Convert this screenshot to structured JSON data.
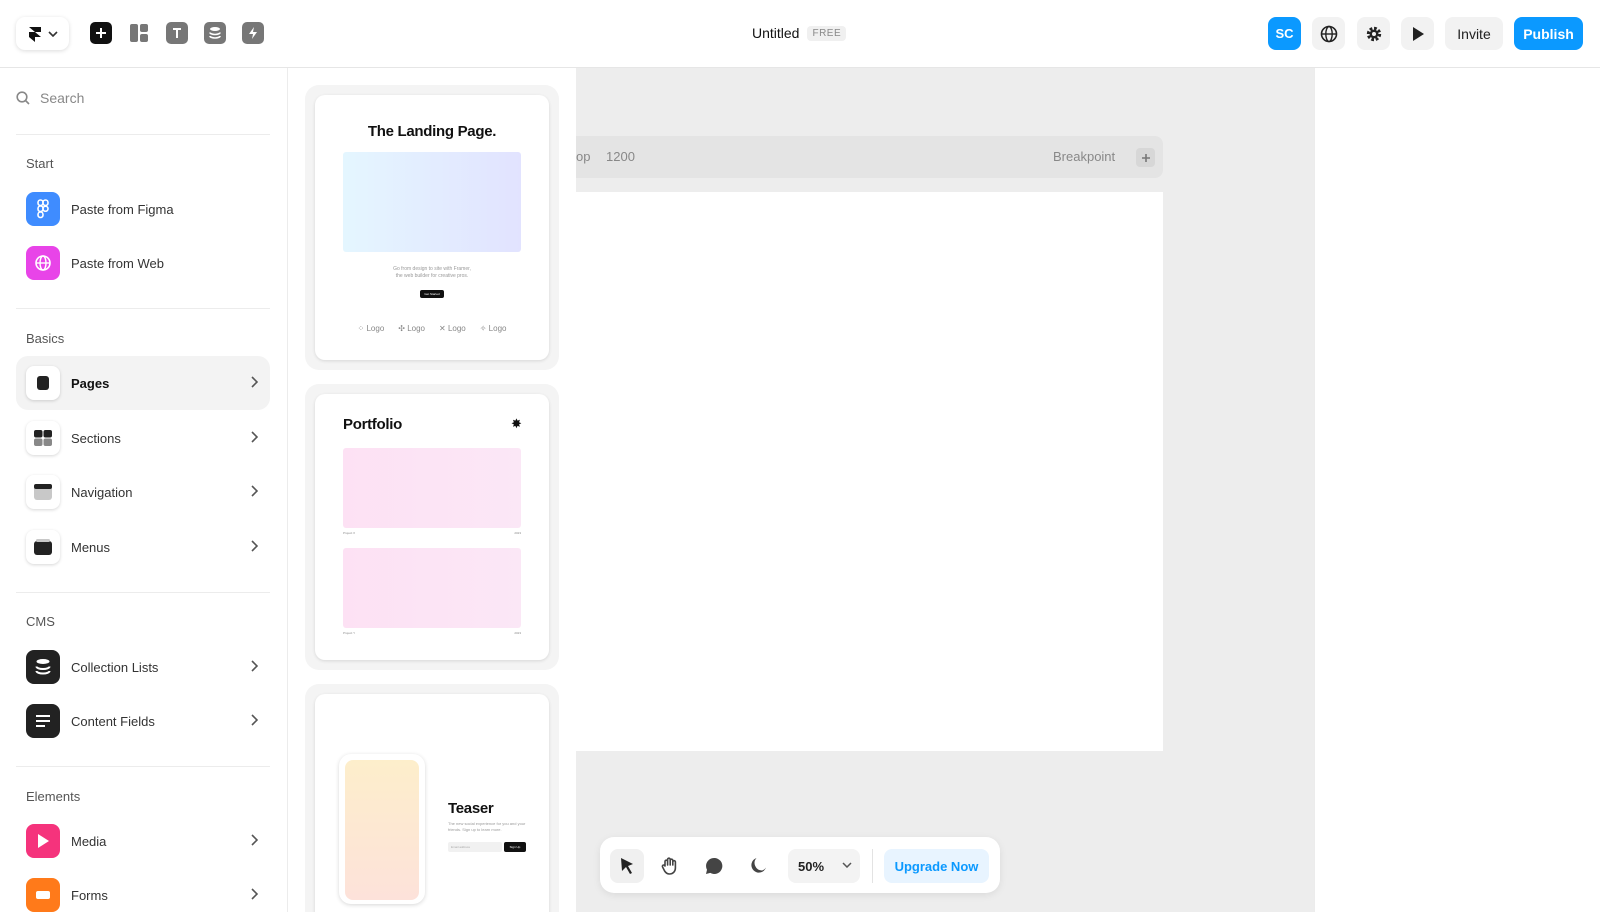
{
  "topbar": {
    "doc_title": "Untitled",
    "plan_badge": "FREE",
    "avatar_initials": "SC",
    "invite_label": "Invite",
    "publish_label": "Publish"
  },
  "sidebar": {
    "search_placeholder": "Search",
    "start": {
      "title": "Start",
      "items": [
        {
          "label": "Paste from Figma",
          "icon": "figma-icon"
        },
        {
          "label": "Paste from Web",
          "icon": "globe-icon"
        }
      ]
    },
    "basics": {
      "title": "Basics",
      "items": [
        {
          "label": "Pages",
          "icon": "page-icon",
          "active": true
        },
        {
          "label": "Sections",
          "icon": "sections-icon"
        },
        {
          "label": "Navigation",
          "icon": "navigation-icon"
        },
        {
          "label": "Menus",
          "icon": "menus-icon"
        }
      ]
    },
    "cms": {
      "title": "CMS",
      "items": [
        {
          "label": "Collection Lists",
          "icon": "database-icon"
        },
        {
          "label": "Content Fields",
          "icon": "text-lines-icon"
        }
      ]
    },
    "elements": {
      "title": "Elements",
      "items": [
        {
          "label": "Media",
          "icon": "play-icon"
        },
        {
          "label": "Forms",
          "icon": "form-icon"
        }
      ]
    }
  },
  "templates": {
    "landing": {
      "title": "The Landing Page.",
      "text_line1": "Go from design to site with Framer,",
      "text_line2": "the web builder for creative pros.",
      "button": "Get Started",
      "logos": [
        "Logo",
        "Logo",
        "Logo",
        "Logo"
      ]
    },
    "portfolio": {
      "title": "Portfolio",
      "mark": "✸",
      "captions": [
        {
          "name": "Project X",
          "year": "2023"
        },
        {
          "name": "Project Y",
          "year": "2023"
        }
      ]
    },
    "teaser": {
      "title": "Teaser",
      "text": "The new social experience for you and your friends. Sign up to learn more.",
      "input_placeholder": "Email address",
      "button": "Sign Up"
    }
  },
  "canvas": {
    "breakpoint_label": "op",
    "breakpoint_width": "1200",
    "breakpoint_add_label": "Breakpoint",
    "zoom": "50%",
    "upgrade_label": "Upgrade Now"
  },
  "colors": {
    "accent": "#0b99ff",
    "figma_tile": "#3f8cff",
    "web_tile": "#e844e8",
    "media_tile": "#f5337c",
    "forms_tile": "#ff7a1a"
  }
}
